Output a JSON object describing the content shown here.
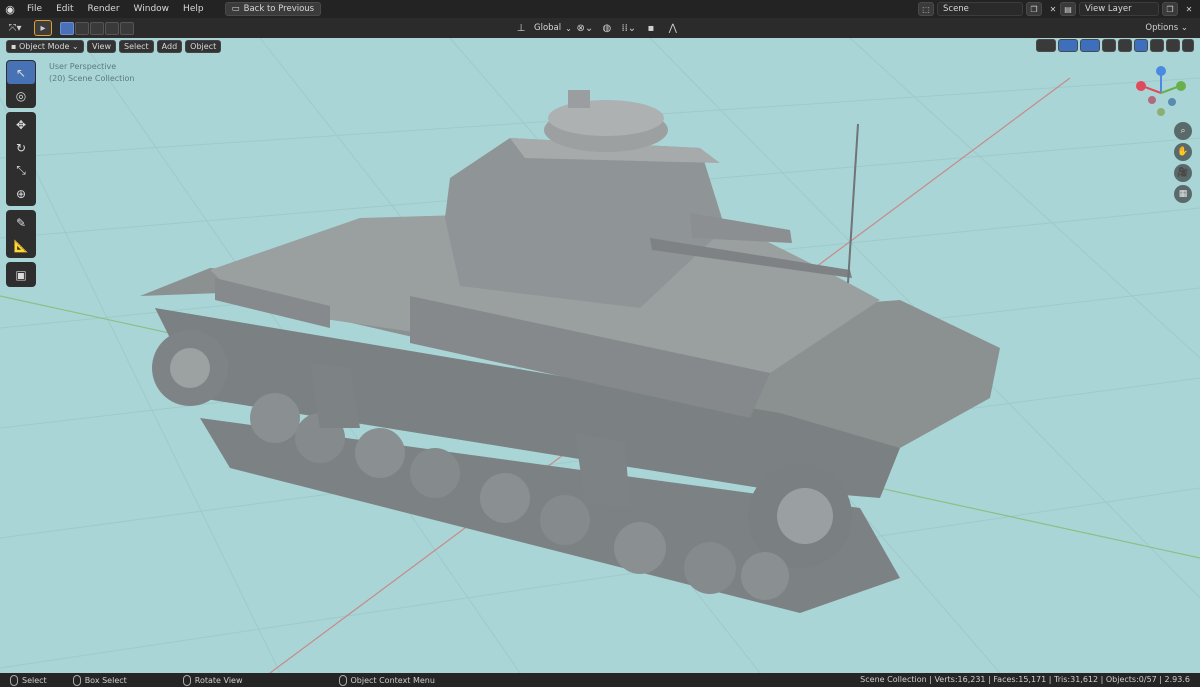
{
  "menu": {
    "items": [
      "File",
      "Edit",
      "Render",
      "Window",
      "Help"
    ],
    "back_button": "Back to Previous"
  },
  "scene": {
    "label": "Scene",
    "view_layer": "View Layer"
  },
  "toolbar": {
    "transform_orientation": "Global",
    "options": "Options"
  },
  "header": {
    "mode": "Object Mode",
    "menus": [
      "View",
      "Select",
      "Add",
      "Object"
    ]
  },
  "viewport": {
    "perspective": "User Perspective",
    "collection": "(20) Scene Collection"
  },
  "status": {
    "select": "Select",
    "box_select": "Box Select",
    "rotate_view": "Rotate View",
    "context_menu": "Object Context Menu",
    "stats": "Scene Collection | Verts:16,231 | Faces:15,171 | Tris:31,612 | Objects:0/57 | 2.93.6"
  },
  "colors": {
    "viewport_bg": "#a9d5d6",
    "accent_blue": "#4772b3",
    "model_gray": "#8a8f90"
  }
}
